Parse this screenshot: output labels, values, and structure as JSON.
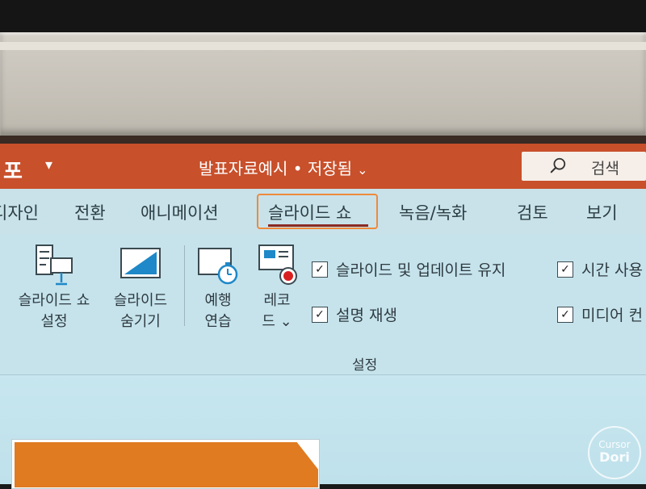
{
  "titlebar": {
    "app_icon": "포",
    "qat_chevron": "▾",
    "doc_title": "발표자료예시 • 저장됨",
    "doc_title_chevron": "⌄",
    "search_label": "검색"
  },
  "tabs": [
    {
      "label": "디자인"
    },
    {
      "label": "전환"
    },
    {
      "label": "애니메이션"
    },
    {
      "label": "슬라이드 쇼",
      "active": true
    },
    {
      "label": "녹음/녹화"
    },
    {
      "label": "검토"
    },
    {
      "label": "보기"
    }
  ],
  "ribbon": {
    "setup_slideshow": {
      "line1": "슬라이드 쇼",
      "line2": "설정"
    },
    "hide_slide": {
      "line1": "슬라이드",
      "line2": "숨기기"
    },
    "rehearse": {
      "line1": "예행",
      "line2": "연습"
    },
    "record": {
      "line1": "레코",
      "line2": "드 ⌄"
    },
    "check_keep_updated": {
      "label": "슬라이드 및 업데이트 유지",
      "checked": true
    },
    "check_play_narration": {
      "label": "설명 재생",
      "checked": true
    },
    "check_use_timings": {
      "label": "시간 사용",
      "checked": true
    },
    "check_show_media": {
      "label": "미디어 컨",
      "checked": true
    },
    "group_label": "설정"
  },
  "watermark": {
    "line1": "Cursor",
    "line2": "Dori"
  },
  "colors": {
    "titlebar_bg": "#c8502b",
    "ribbon_bg": "#c6e3ec",
    "active_tab_outline": "#ee8a3a",
    "active_tab_underline": "#8b2b22",
    "slide_shape": "#e07b22"
  }
}
